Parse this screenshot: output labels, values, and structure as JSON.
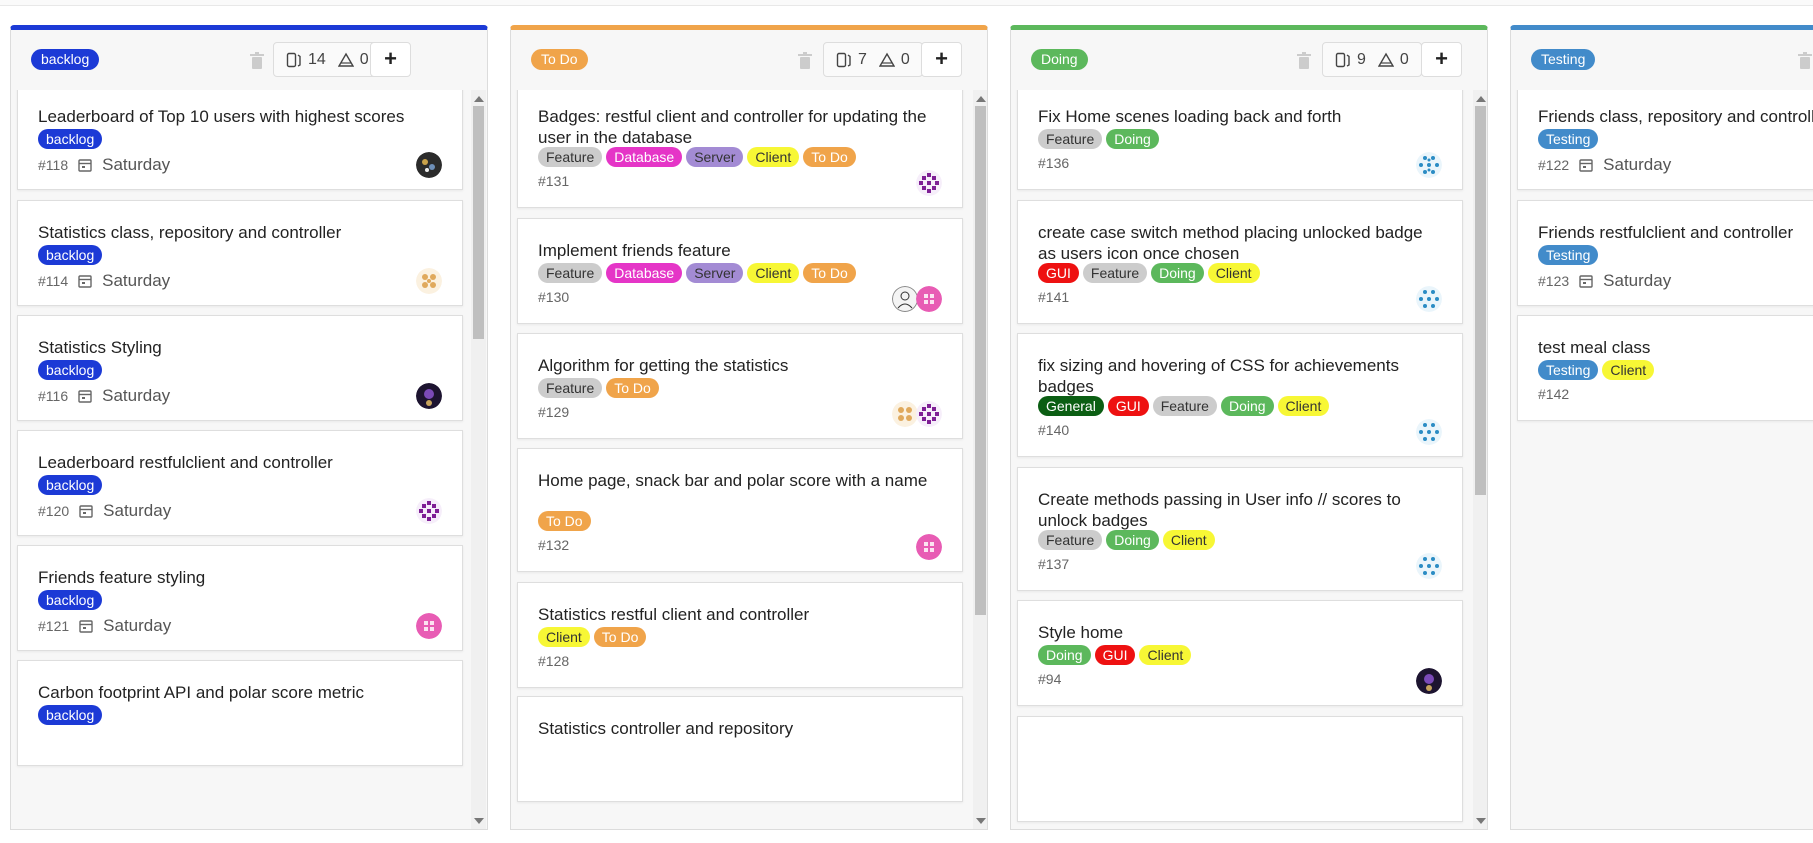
{
  "colors": {
    "backlog": "#1c3ad6",
    "todo": "#f0a44a",
    "doing": "#5cb85c",
    "testing": "#428bca",
    "Feature": "#cccccc",
    "Database": "#e535c7",
    "Server": "#a38bd4",
    "Client": "#f7f735",
    "GUI": "#ee1111",
    "General": "#0b5e13"
  },
  "columns": [
    {
      "label": "backlog",
      "task_count": "14",
      "warn_count": "0",
      "cards": [
        {
          "title": "Leaderboard of Top 10 users with highest scores",
          "tags": [
            "backlog"
          ],
          "number": "#118",
          "date": "Saturday",
          "avatar": "dark-avatar-icon"
        },
        {
          "title": "Statistics class, repository and controller",
          "tags": [
            "backlog"
          ],
          "number": "#114",
          "date": "Saturday",
          "avatar": "tan-pattern-avatar-icon"
        },
        {
          "title": "Statistics Styling",
          "tags": [
            "backlog"
          ],
          "number": "#116",
          "date": "Saturday",
          "avatar": "purple-dark-avatar-icon"
        },
        {
          "title": "Leaderboard restfulclient and controller",
          "tags": [
            "backlog"
          ],
          "number": "#120",
          "date": "Saturday",
          "avatar": "purple-pattern-avatar-icon"
        },
        {
          "title": "Friends feature styling",
          "tags": [
            "backlog"
          ],
          "number": "#121",
          "date": "Saturday",
          "avatar": "pink-pattern-avatar-icon"
        },
        {
          "title": "Carbon footprint API and polar score metric",
          "tags": [
            "backlog"
          ],
          "number": "",
          "date": "",
          "avatar": ""
        }
      ]
    },
    {
      "label": "To Do",
      "task_count": "7",
      "warn_count": "0",
      "cards": [
        {
          "title": "Badges: restful client and controller for updating the user in the database",
          "tags": [
            "Feature",
            "Database",
            "Server",
            "Client",
            "To Do"
          ],
          "number": "#131",
          "date": "",
          "avatar": "purple-pattern-avatar-icon"
        },
        {
          "title": "Implement friends feature",
          "tags": [
            "Feature",
            "Database",
            "Server",
            "Client",
            "To Do"
          ],
          "number": "#130",
          "date": "",
          "avatar": "pink-pattern-avatar-icon",
          "avatar2": "sketch-avatar-icon"
        },
        {
          "title": "Algorithm for getting the statistics",
          "tags": [
            "Feature",
            "To Do"
          ],
          "number": "#129",
          "date": "",
          "avatar": "purple-pattern-avatar-icon",
          "avatar2": "tan-pattern-avatar-icon"
        },
        {
          "title": "Home page, snack bar and polar score with a name",
          "tags": [
            "To Do"
          ],
          "number": "#132",
          "date": "",
          "avatar": "pink-pattern-avatar-icon"
        },
        {
          "title": "Statistics restful client and controller",
          "tags": [
            "Client",
            "To Do"
          ],
          "number": "#128",
          "date": "",
          "avatar": ""
        },
        {
          "title": "Statistics controller and repository",
          "tags": [],
          "number": "",
          "date": "",
          "avatar": ""
        }
      ]
    },
    {
      "label": "Doing",
      "task_count": "9",
      "warn_count": "0",
      "cards": [
        {
          "title": "Fix Home scenes loading back and forth",
          "tags": [
            "Feature",
            "Doing"
          ],
          "number": "#136",
          "date": "",
          "avatar": "blue-pattern-avatar-icon"
        },
        {
          "title": "create case switch method placing unlocked badge as users icon once chosen",
          "tags": [
            "GUI",
            "Feature",
            "Doing",
            "Client"
          ],
          "number": "#141",
          "date": "",
          "avatar": "blue-pattern-avatar-icon"
        },
        {
          "title": "fix sizing and hovering of CSS for achievements badges",
          "tags": [
            "General",
            "GUI",
            "Feature",
            "Doing",
            "Client"
          ],
          "number": "#140",
          "date": "",
          "avatar": "blue-pattern-avatar-icon"
        },
        {
          "title": "Create methods passing in User info // scores to unlock badges",
          "tags": [
            "Feature",
            "Doing",
            "Client"
          ],
          "number": "#137",
          "date": "",
          "avatar": "blue-pattern-avatar-icon"
        },
        {
          "title": "Style home",
          "tags": [
            "Doing",
            "GUI",
            "Client"
          ],
          "number": "#94",
          "date": "",
          "avatar": "purple-dark-avatar-icon"
        }
      ]
    },
    {
      "label": "Testing",
      "task_count": "",
      "warn_count": "",
      "cards": [
        {
          "title": "Friends class, repository and controller",
          "tags": [
            "Testing"
          ],
          "number": "#122",
          "date": "Saturday",
          "avatar": ""
        },
        {
          "title": "Friends restfulclient and controller",
          "tags": [
            "Testing"
          ],
          "number": "#123",
          "date": "Saturday",
          "avatar": ""
        },
        {
          "title": "test meal class",
          "tags": [
            "Testing",
            "Client"
          ],
          "number": "#142",
          "date": "",
          "avatar": ""
        }
      ]
    }
  ]
}
